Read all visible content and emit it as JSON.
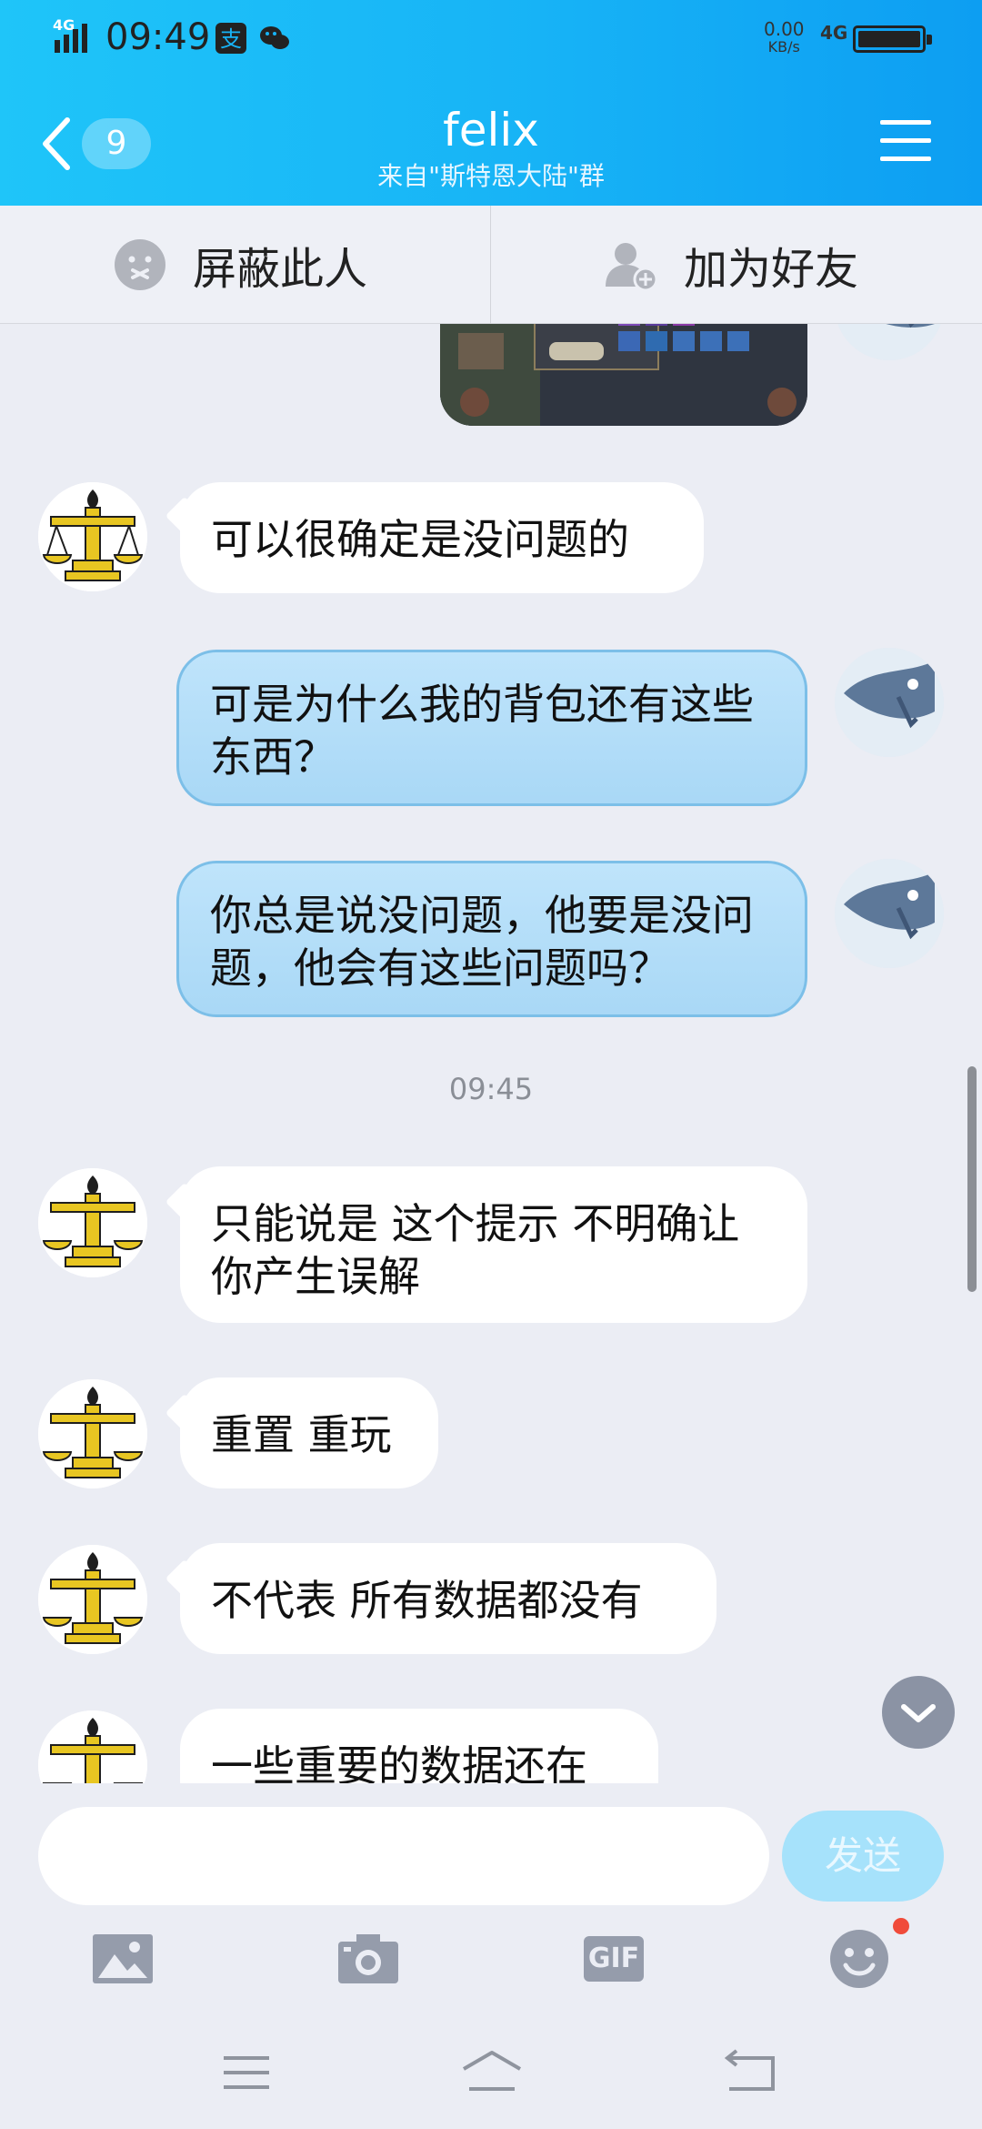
{
  "status_bar": {
    "network_small": "4G",
    "time": "09:49",
    "speed_value": "0.00",
    "speed_unit": "KB/s",
    "network": "4G"
  },
  "header": {
    "back_count": "9",
    "title": "felix",
    "subtitle": "来自\"斯特恩大陆\"群"
  },
  "actions": {
    "block_label": "屏蔽此人",
    "add_friend_label": "加为好友"
  },
  "messages": [
    {
      "sender": "other",
      "text": "可以很确定是没问题的"
    },
    {
      "sender": "me",
      "text": "可是为什么我的背包还有这些东西？"
    },
    {
      "sender": "me",
      "text": "你总是说没问题，他要是没问题，他会有这些问题吗？"
    },
    {
      "sender": "other",
      "text": "只能说是 这个提示 不明确让你产生误解"
    },
    {
      "sender": "other",
      "text": "重置 重玩"
    },
    {
      "sender": "other",
      "text": "不代表 所有数据都没有"
    },
    {
      "sender": "other",
      "text": "一些重要的数据还在"
    }
  ],
  "timestamp": "09:45",
  "input": {
    "value": "",
    "send_label": "发送"
  },
  "toolbar": {
    "gif_label": "GIF"
  },
  "colors": {
    "header_start": "#1fc5f9",
    "header_end": "#0d9ef2",
    "my_bubble": "#b4ddf8",
    "send_button": "#a6e2fb",
    "notify_dot": "#f04b3a"
  }
}
